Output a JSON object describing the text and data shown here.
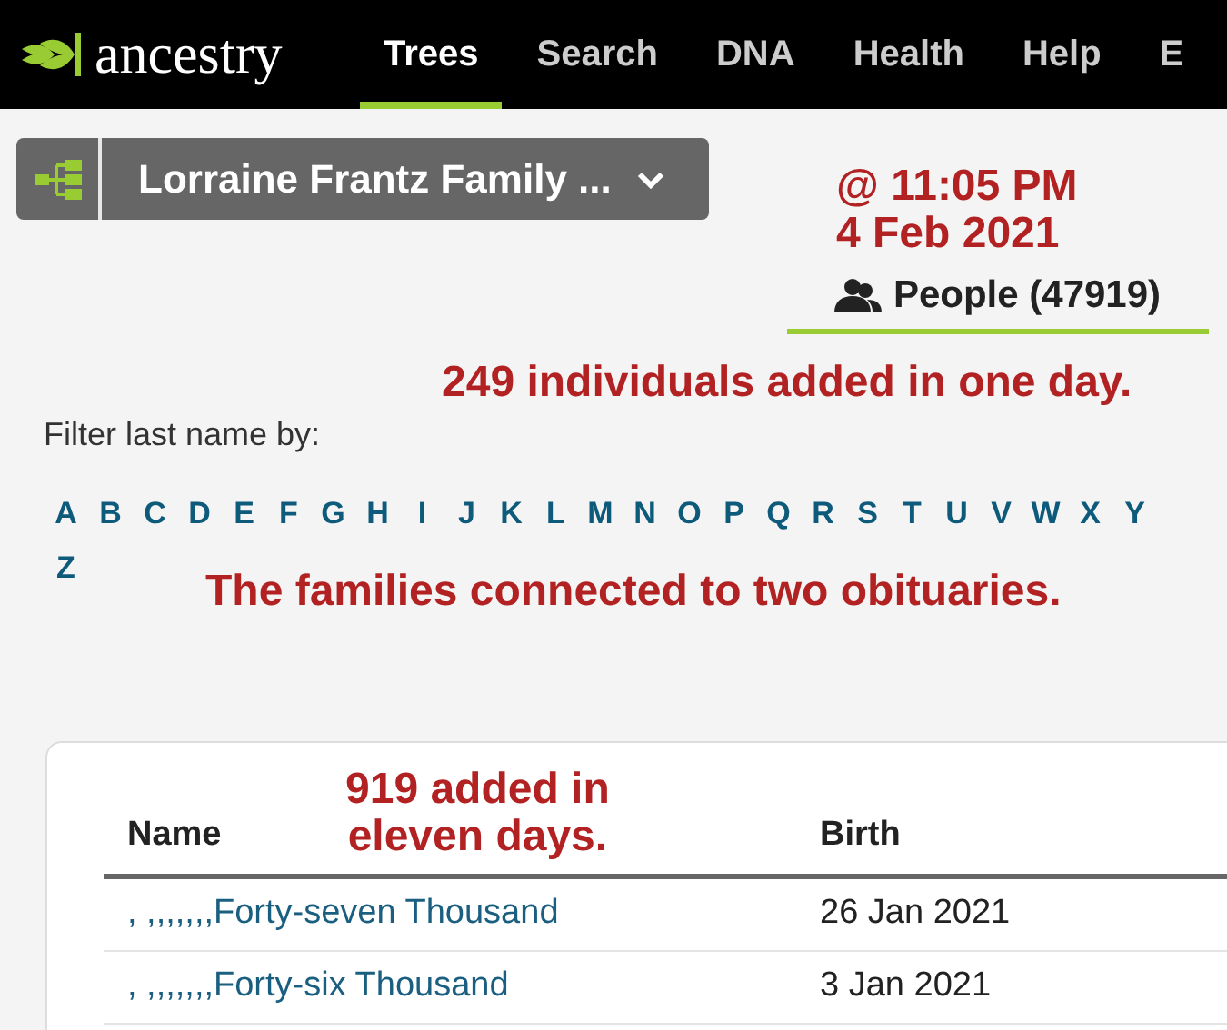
{
  "nav": {
    "logo": "ancestry",
    "tabs": [
      {
        "label": "Trees",
        "selected": true
      },
      {
        "label": "Search",
        "selected": false
      },
      {
        "label": "DNA",
        "selected": false
      },
      {
        "label": "Health",
        "selected": false
      },
      {
        "label": "Help",
        "selected": false
      },
      {
        "label": "E",
        "selected": false
      }
    ]
  },
  "tree_selector": {
    "title": "Lorraine Frantz Family ..."
  },
  "people_tab": {
    "label": "People (47919)",
    "selected": true
  },
  "filter": {
    "label": "Filter last name by:",
    "letters": [
      "A",
      "B",
      "C",
      "D",
      "E",
      "F",
      "G",
      "H",
      "I",
      "J",
      "K",
      "L",
      "M",
      "N",
      "O",
      "P",
      "Q",
      "R",
      "S",
      "T",
      "U",
      "V",
      "W",
      "X",
      "Y",
      "Z"
    ]
  },
  "table": {
    "columns": [
      "Name",
      "Birth"
    ],
    "rows": [
      {
        "name": ", ,,,,,,,Forty-seven Thousand",
        "birth": "26 Jan 2021"
      },
      {
        "name": ", ,,,,,,,Forty-six Thousand",
        "birth": "3 Jan 2021"
      }
    ]
  },
  "annotations": [
    {
      "kind": "time",
      "lines": [
        "@ 11:05 PM",
        "4 Feb 2021"
      ]
    },
    {
      "kind": "day",
      "lines": [
        "249 individuals added in one day."
      ]
    },
    {
      "kind": "families",
      "lines": [
        "The families connected to two obituaries."
      ]
    },
    {
      "kind": "eleven",
      "lines": [
        "919 added in",
        "eleven days."
      ]
    }
  ]
}
